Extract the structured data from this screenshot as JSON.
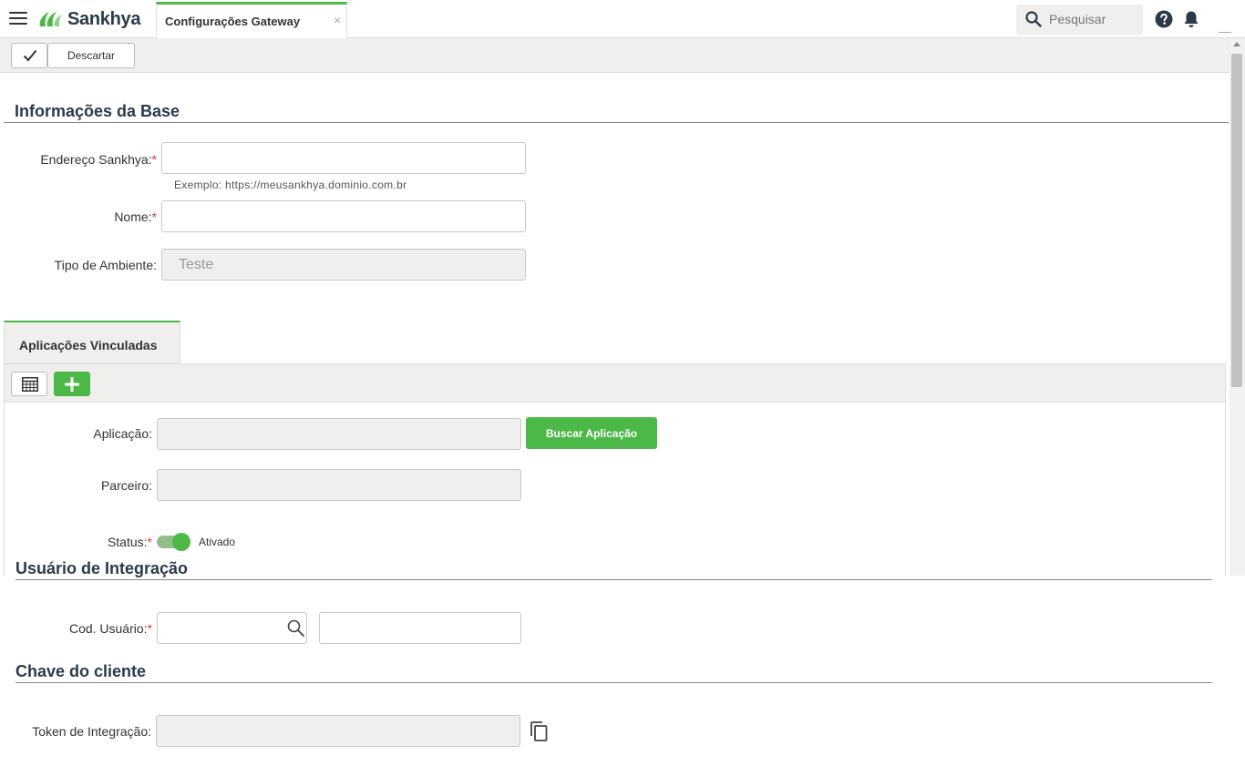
{
  "header": {
    "brand": "Sankhya",
    "active_tab": "Configurações Gateway",
    "tab_close": "×",
    "search_placeholder": "Pesquisar"
  },
  "toolbar": {
    "discard_label": "Descartar"
  },
  "base_section": {
    "title": "Informações da Base",
    "endereco_label": "Endereço Sankhya:",
    "endereco_value": "",
    "endereco_hint": "Exemplo: https://meusankhya.dominio.com.br",
    "nome_label": "Nome:",
    "nome_value": "",
    "ambiente_label": "Tipo de Ambiente:",
    "ambiente_value": "Teste",
    "required_mark": "*"
  },
  "apps_tab": {
    "label": "Aplicações Vinculadas",
    "aplicacao_label": "Aplicação:",
    "aplicacao_value": "",
    "buscar_label": "Buscar Aplicação",
    "parceiro_label": "Parceiro:",
    "parceiro_value": "",
    "status_label": "Status:",
    "status_text": "Ativado",
    "status_on": true
  },
  "integration_user": {
    "title": "Usuário de Integração",
    "cod_label": "Cod. Usuário:",
    "cod_value": "",
    "name_value": ""
  },
  "client_key": {
    "title": "Chave do cliente",
    "token_label": "Token de Integração:",
    "token_value": ""
  },
  "colors": {
    "brand_green": "#4cb848",
    "title_dark": "#2b3a4a",
    "required_red": "#e53935",
    "panel_gray": "#f0efed"
  }
}
